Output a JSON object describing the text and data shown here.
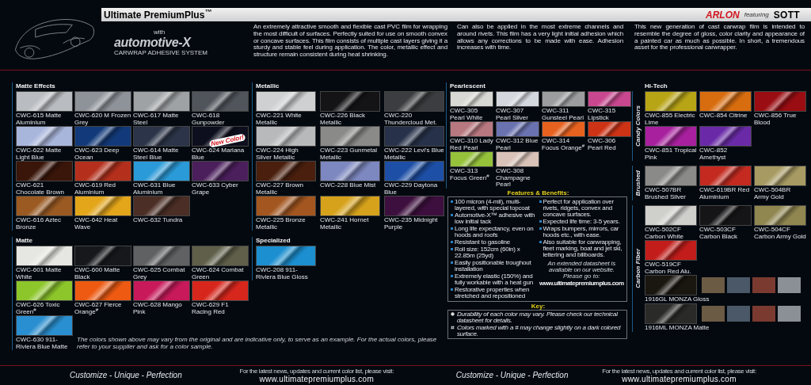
{
  "header": {
    "title": "Ultimate PremiumPlus$^{™}$",
    "adhesive_logo": {
      "prefix": "with",
      "name": "automotive-X",
      "tagline": "CARWRAP ADHESIVE SYSTEM"
    },
    "brand": "ARLON",
    "featuring": "featuring",
    "partner": "SOTT"
  },
  "intro": [
    "An extremely attractive smooth and flexible cast PVC film for wrapping the most difficult of surfaces. Perfectly suited for use on smooth convex or concave surfaces. This film consists of multiple cast layers giving it a sturdy and stable feel during application. The color, metallic effect and structure remain consistent during heat shrinking.",
    "Can also be applied in the most extreme channels and around rivets. This film has a very light initial adhesion which allows any corrections to be made with ease. Adhesion increases with time.",
    "This new generation of cast carwrap film is intended to resemble the degree of gloss, color clarity and appearance of a painted car as much as possible. In short, a tremendous asset for the professional carwrapper."
  ],
  "panels": [
    {
      "sections": [
        {
          "title": "Matte Effects",
          "swatches": [
            {
              "label": "CWC-615 Matte Aluminium",
              "color": "#b9bcc0"
            },
            {
              "label": "CWC-620 M Frozen Grey",
              "color": "#8e939a"
            },
            {
              "label": "CWC-617 Matte Steel",
              "color": "#9fa2a5"
            },
            {
              "label": "CWC-618 Gunpowder",
              "color": "#50555c"
            },
            {
              "label": "CWC-622 Matte Light Blue",
              "color": "#a9b6dc"
            },
            {
              "label": "CWC-623 Deep Ocean",
              "color": "#123a7a"
            },
            {
              "label": "CWC-614 Matte Steel Blue",
              "color": "#2b3448"
            },
            {
              "label": "CWC-624 Mariana Blue",
              "color": "#0d0f1e",
              "badge": "New Color!"
            },
            {
              "label": "CWC-621 Chocolate Brown",
              "color": "#3a1509"
            },
            {
              "label": "CWC-619 Red Aluminium",
              "color": "#b5301c"
            },
            {
              "label": "CWC-631 Blue Aluminium",
              "color": "#2a9ad8"
            },
            {
              "label": "CWC-633 Cyber Grape",
              "color": "#4b1f5c"
            },
            {
              "label": "CWC-616 Aztec Bronze",
              "color": "#9a5a22"
            },
            {
              "label": "CWC-642 Heat Wave",
              "color": "#e3a51a"
            },
            {
              "label": "CWC-632 Tundra",
              "color": "#4b2e25"
            }
          ]
        },
        {
          "title": "Matte",
          "swatches": [
            {
              "label": "CWC-601 Matte White",
              "color": "#e6e6e2"
            },
            {
              "label": "CWC-600 Matte Black",
              "color": "#16181c"
            },
            {
              "label": "CWC-625 Combat Grey",
              "color": "#5f6163"
            },
            {
              "label": "CWC-624 Combat Green",
              "color": "#5f5f4a"
            },
            {
              "label": "CWC-626 Toxic Green$^{#}$",
              "color": "#8cc62a"
            },
            {
              "label": "CWC-627 Fierce Orange$^{#}$",
              "color": "#ee5a12"
            },
            {
              "label": "CWC-628 Mango Pink",
              "color": "#c8195a"
            },
            {
              "label": "CWC-629 F1 Racing Red",
              "color": "#d7261c"
            },
            {
              "label": "CWC-630 911-Riviera Blue Matte",
              "color": "#2a8fd0"
            }
          ]
        }
      ]
    },
    {
      "sections": [
        {
          "title": "Metallic",
          "swatches": [
            {
              "label": "CWC-221 White Metallic",
              "color": "#cfd0d2"
            },
            {
              "label": "CWC-226 Black Metallic",
              "color": "#141416"
            },
            {
              "label": "CWC-220 Thundercloud Met.",
              "color": "#3b3d40"
            },
            {
              "label": "CWC-224 High Silver Metallic",
              "color": "#b8b9bb"
            },
            {
              "label": "CWC-223 Gunmetal Metallic",
              "color": "#8a8a89"
            },
            {
              "label": "CWC-222 Levi's Blue Metallic",
              "color": "#27324a"
            },
            {
              "label": "CWC-227 Brown Metallic",
              "color": "#4a1f0e"
            },
            {
              "label": "CWC-228 Blue Mist",
              "color": "#7d88c0"
            },
            {
              "label": "CWC-229 Daytona Blue",
              "color": "#1d4fa6"
            },
            {
              "label": "CWC-225 Bronze Metallic",
              "color": "#a3561f"
            },
            {
              "label": "CWC-241 Hornet Metallic",
              "color": "#d6a21b"
            },
            {
              "label": "CWC-235 Midnight Purple",
              "color": "#3d0f3e"
            }
          ]
        },
        {
          "title": "Specialized",
          "swatches": [
            {
              "label": "CWC-208 911-Riviera Blue Gloss",
              "color": "#1b8fd0"
            }
          ]
        }
      ]
    },
    {
      "sections": [
        {
          "title": "Pearlescent",
          "swatches": [
            {
              "label": "CWC-305 Pearl White",
              "color": "#d8d8d4"
            },
            {
              "label": "CWC-307 Pearl Silver",
              "color": "#d3d7de"
            },
            {
              "label": "CWC-311 Gunsteel Pearl",
              "color": "#9c9d9f"
            },
            {
              "label": "CWC-315 Lipstick",
              "color": "#c8478f"
            },
            {
              "label": "CWC-310 Lady Red Pearl",
              "color": "#b87880"
            },
            {
              "label": "CWC-312 Blue Pearl",
              "color": "#6a72b0"
            },
            {
              "label": "CWC-314 Focus Orange$^{#}$",
              "color": "#e7621f"
            },
            {
              "label": "CWC-306 Pearl Red",
              "color": "#cf3315"
            },
            {
              "label": "CWC-313 Focus Green$^{#}$",
              "color": "#95c23a"
            },
            {
              "label": "CWC-308 Champagne Pearl",
              "color": "#d9c2b8"
            }
          ]
        }
      ],
      "features": {
        "title": "Features & Benefits:",
        "left": [
          "100 micron (4-mil), multi-layered, with special topcoat",
          "Automotive-X™ adhesive with low initial tack",
          "Long life expectancy, even on hoods and roofs",
          "Resistant to gasoline",
          "Roll size: 152cm (60in) x 22.85m (25yd)",
          "Easily positionable troughout installation",
          "Extremely elastic (150%) and fully workable with a heat gun",
          "Restorative properties when stretched and repositioned"
        ],
        "right": [
          "Perfect for application over rivets, ridgets, convex and concave surfaces.",
          "Expected life time: 3-5 years.",
          "Wraps bumpers, mirrors, car hoods etc., with ease.",
          "Also suitable for carwrapping, fleet marking, boat and jet ski, lettering and billboards."
        ],
        "note": "An extended datasheet is available on our website.",
        "prompt": "Please go to:",
        "url": "www.ultimatepremiumplus.com"
      },
      "key": {
        "title": "Key:",
        "items": [
          {
            "kind": "durability",
            "text": "Durability of each color may vary. Please check our technical datasheet for details."
          },
          {
            "kind": "hash",
            "text": "Colors marked with a # may change slightly on a dark colored surface."
          }
        ]
      }
    },
    {
      "sections": [
        {
          "title": "Hi-Tech",
          "groups": [
            {
              "label": "Candy Colors",
              "swatches": [
                {
                  "label": "CWC-855 Electric Lime",
                  "color": "#b8a516"
                },
                {
                  "label": "CWC-854 Citrine",
                  "color": "#d86d0f"
                },
                {
                  "label": "CWC-856 True Blood",
                  "color": "#9a0d12"
                },
                {
                  "label": "CWC-851 Tropical Pink",
                  "color": "#a8209e"
                },
                {
                  "label": "CWC-852 Amethyst",
                  "color": "#6a2aa8"
                }
              ]
            },
            {
              "label": "Brushed",
              "swatches": [
                {
                  "label": "CWC-507BR Brushed Silver",
                  "color": "#8a8a88"
                },
                {
                  "label": "CWC-619BR Red Aluminium",
                  "color": "#c42a20"
                },
                {
                  "label": "CWC-504BR Army Gold",
                  "color": "#a79a62"
                }
              ]
            },
            {
              "label": "Carbon Fiber",
              "swatches": [
                {
                  "label": "CWC-502CF Carbon White",
                  "color": "#cfcfcc"
                },
                {
                  "label": "CWC-503CF Carbon Black",
                  "color": "#151517"
                },
                {
                  "label": "CWC-504CF Carbon Army Gold",
                  "color": "#8f8650"
                },
                {
                  "label": "CWC-519CF Carbon Red Alu.",
                  "color": "#c21d1a"
                },
                {
                  "kind": "with_photos",
                  "label": "1916GL MONZA Gloss",
                  "color": "#1a1610"
                },
                {
                  "kind": "with_photos",
                  "label": "1916ML MONZA Matte",
                  "color": "#2a2a28"
                }
              ]
            }
          ]
        }
      ]
    }
  ],
  "disclaimer": "The colors shown above may vary from the original and are indicative only, to serve as an example. For the actual colors, please refer to your supplier and ask for a color sample.",
  "footer": [
    {
      "slogan": "Customize - Unique - Perfection",
      "note": "For the latest news, updates and current color list, please visit:",
      "url": "www.ultimatepremiumplus.com"
    },
    {
      "slogan": "Customize - Unique - Perfection",
      "note": "For the latest news, updates and current color list, please visit:",
      "url": "www.ultimatepremiumplus.com"
    }
  ]
}
